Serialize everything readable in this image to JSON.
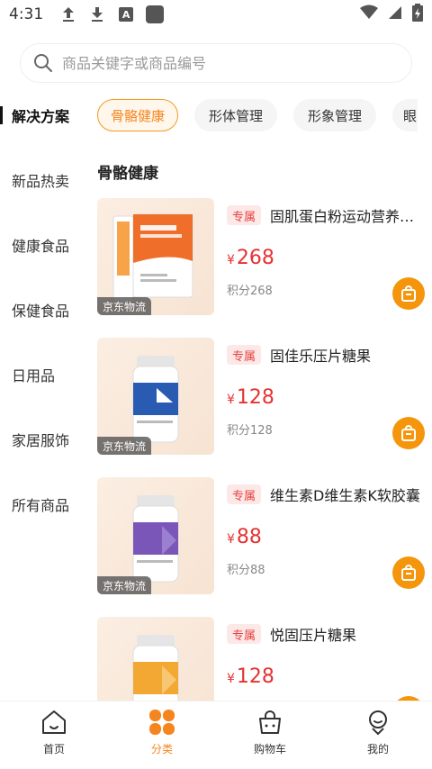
{
  "status_bar": {
    "time": "4:31",
    "icons": [
      "upload-icon",
      "download-icon",
      "a-icon",
      "app-square-icon"
    ],
    "right_icons": [
      "wifi-icon",
      "signal-icon",
      "battery-icon"
    ]
  },
  "search": {
    "placeholder": "商品关键字或商品编号"
  },
  "sidebar": {
    "items": [
      {
        "label": "解决方案",
        "active": true
      },
      {
        "label": "新品热卖"
      },
      {
        "label": "健康食品"
      },
      {
        "label": "保健食品"
      },
      {
        "label": "日用品"
      },
      {
        "label": "家居服饰"
      },
      {
        "label": "所有商品"
      }
    ]
  },
  "tabs": [
    {
      "label": "骨骼健康",
      "active": true
    },
    {
      "label": "形体管理"
    },
    {
      "label": "形象管理"
    },
    {
      "label": "眼"
    }
  ],
  "section": {
    "title": "骨骼健康"
  },
  "products": [
    {
      "tag": "专属",
      "name": "固肌蛋白粉运动营养食品",
      "currency": "¥",
      "price": "268",
      "points": "积分268",
      "badge": "京东物流"
    },
    {
      "tag": "专属",
      "name": "固佳乐压片糖果",
      "currency": "¥",
      "price": "128",
      "points": "积分128",
      "badge": "京东物流"
    },
    {
      "tag": "专属",
      "name": "维生素D维生素K软胶囊",
      "currency": "¥",
      "price": "88",
      "points": "积分88",
      "badge": "京东物流"
    },
    {
      "tag": "专属",
      "name": "悦固压片糖果",
      "currency": "¥",
      "price": "128",
      "points": "",
      "badge": ""
    }
  ],
  "bottom_nav": [
    {
      "label": "首页",
      "icon": "home-icon"
    },
    {
      "label": "分类",
      "icon": "category-icon",
      "active": true
    },
    {
      "label": "购物车",
      "icon": "cart-icon"
    },
    {
      "label": "我的",
      "icon": "profile-icon"
    }
  ],
  "colors": {
    "accent": "#f5861f",
    "price": "#e63232",
    "cart_button": "#f5950b",
    "tag_bg": "#fde8e8"
  }
}
